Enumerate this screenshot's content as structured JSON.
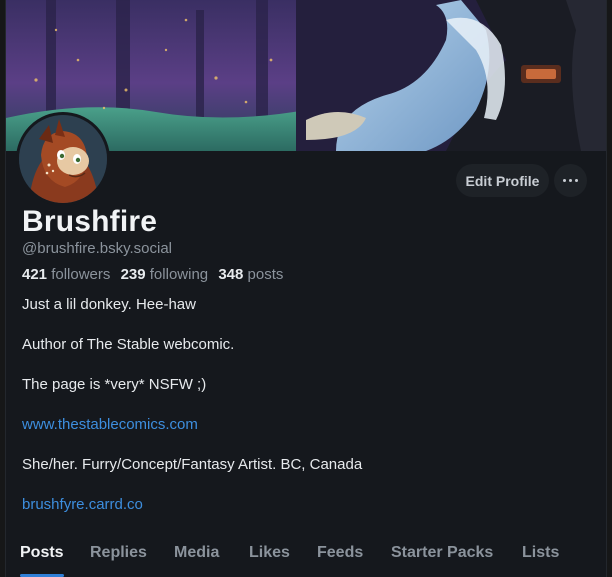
{
  "profile": {
    "display_name": "Brushfire",
    "handle": "@brushfire.bsky.social",
    "followers_count": "421",
    "followers_label": "followers",
    "following_count": "239",
    "following_label": "following",
    "posts_count": "348",
    "posts_label": "posts"
  },
  "actions": {
    "edit_profile_label": "Edit Profile",
    "more_icon": "ellipsis-horizontal-icon"
  },
  "bio": {
    "line1": "Just a lil donkey. Hee-haw",
    "line2": "Author of The Stable webcomic.",
    "line3": "The page is *very* NSFW ;)",
    "link1": "www.thestablecomics.com",
    "line4": "She/her. Furry/Concept/Fantasy Artist. BC, Canada",
    "link2": "brushfyre.carrd.co"
  },
  "tabs": [
    {
      "label": "Posts",
      "active": true
    },
    {
      "label": "Replies",
      "active": false
    },
    {
      "label": "Media",
      "active": false
    },
    {
      "label": "Likes",
      "active": false
    },
    {
      "label": "Feeds",
      "active": false
    },
    {
      "label": "Starter Packs",
      "active": false
    },
    {
      "label": "Lists",
      "active": false
    }
  ],
  "colors": {
    "background": "#15181d",
    "link": "#3d8ede",
    "accent_underline": "#2f7fd6",
    "muted_text": "#8b939c"
  }
}
